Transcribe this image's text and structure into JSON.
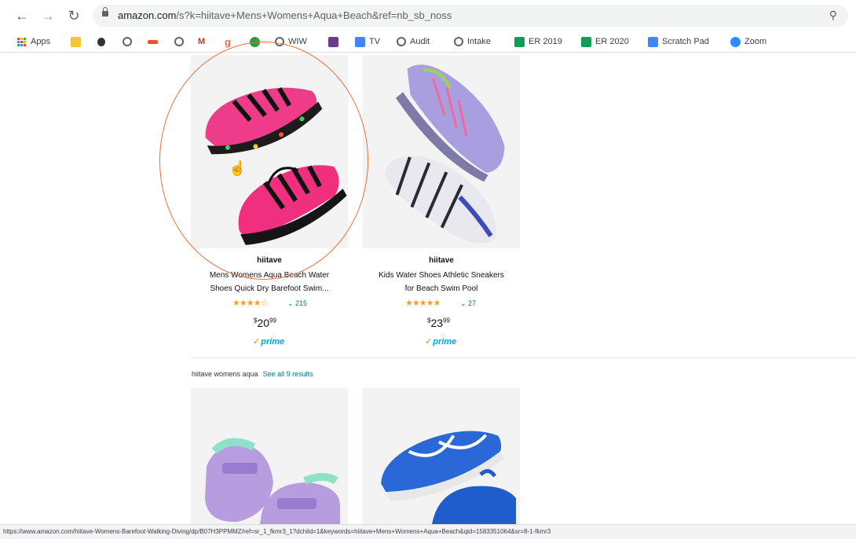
{
  "browser": {
    "url_host": "amazon.com",
    "url_rest": "/s?k=hiitave+Mens+Womens+Aqua+Beach&ref=nb_sb_noss",
    "back_icon": "arrow-left-icon",
    "forward_icon": "arrow-right-icon",
    "reload_icon": "reload-icon"
  },
  "bookmarks": {
    "apps": "Apps",
    "wiw": "WIW",
    "tv": "TV",
    "audit": "Audit",
    "intake": "Intake",
    "er2019": "ER 2019",
    "er2020": "ER 2020",
    "scratch": "Scratch Pad",
    "zoom": "Zoom"
  },
  "results": [
    {
      "brand": "hiitave",
      "title_line1": "Mens Womens Aqua Beach Water",
      "title_line2": "Shoes Quick Dry Barefoot Swim...",
      "stars": "★★★★☆",
      "rating_count": "215",
      "price_whole": "20",
      "price_fraction": "99",
      "prime": "prime"
    },
    {
      "brand": "hiitave",
      "title_line1": "Kids Water Shoes Athletic Sneakers",
      "title_line2": "for Beach Swim Pool",
      "stars": "★★★★★",
      "rating_count": "27",
      "price_whole": "23",
      "price_fraction": "99",
      "prime": "prime"
    }
  ],
  "section": {
    "title": "hiitave womens aqua",
    "see_all": "See all 9 results"
  },
  "status_url": "https://www.amazon.com/hiitave-Womens-Barefoot-Walking-Diving/dp/B07H3PPMMZ/ref=sr_1_fkmr3_1?dchild=1&keywords=hiitave+Mens+Womens+Aqua+Beach&qid=1583351064&sr=8-1-fkmr3",
  "colors": {
    "accent_link": "#007185",
    "star": "#f0a030",
    "prime": "#00a8e1",
    "annotation_circle": "#e8703a"
  }
}
